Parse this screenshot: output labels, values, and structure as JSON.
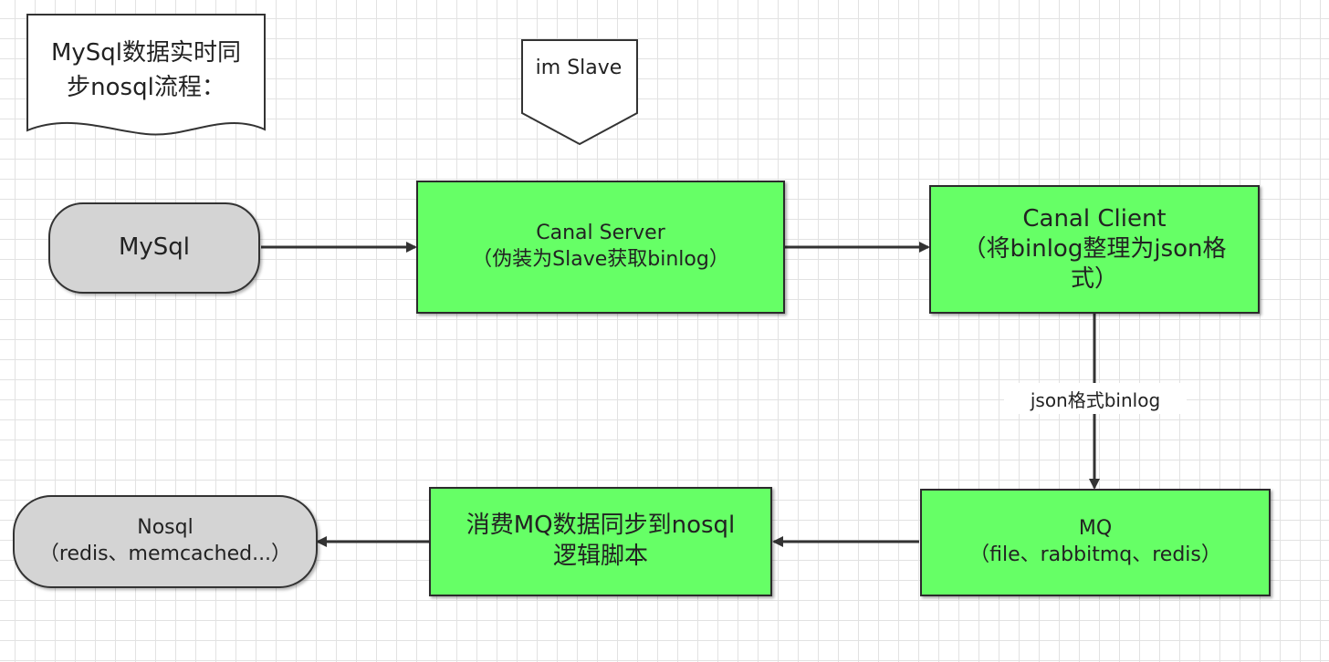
{
  "note": {
    "line1": "MySql数据实时同",
    "line2": "步nosql流程："
  },
  "callout": {
    "text": "im Slave"
  },
  "nodes": {
    "mysql": {
      "label": "MySql"
    },
    "canal_server": {
      "line1": "Canal Server",
      "line2": "（伪装为Slave获取binlog）"
    },
    "canal_client": {
      "line1": "Canal Client",
      "line2": "（将binlog整理为json格",
      "line3": "式）"
    },
    "mq": {
      "line1": "MQ",
      "line2": "（file、rabbitmq、redis）"
    },
    "consumer": {
      "line1": "消费MQ数据同步到nosql",
      "line2": "逻辑脚本"
    },
    "nosql": {
      "line1": "Nosql",
      "line2": "（redis、memcached...）"
    }
  },
  "edges": {
    "client_to_mq_label": "json格式binlog"
  },
  "colors": {
    "process_fill": "#66ff66",
    "terminal_fill": "#d4d4d4",
    "stroke": "#333333"
  }
}
